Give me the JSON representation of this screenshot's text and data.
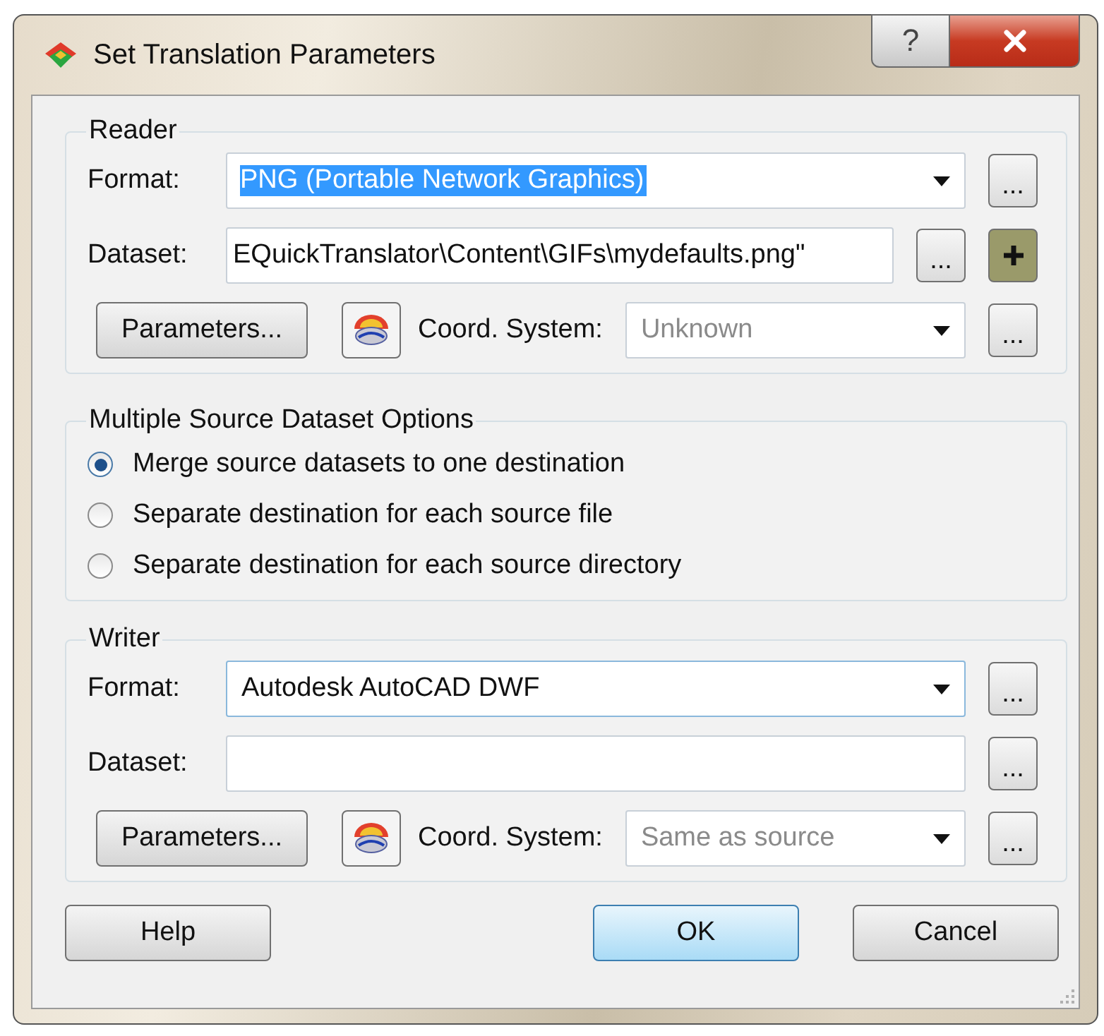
{
  "window": {
    "title": "Set Translation Parameters",
    "help_button": "?"
  },
  "reader": {
    "title": "Reader",
    "format": {
      "label": "Format:",
      "value": "PNG (Portable Network Graphics)",
      "selected": true,
      "browse": "..."
    },
    "dataset": {
      "label": "Dataset:",
      "value": "EQuickTranslator\\Content\\GIFs\\mydefaults.png\"",
      "browse": "..."
    },
    "parameters_button": "Parameters...",
    "coord_system": {
      "label": "Coord. System:",
      "value": "Unknown",
      "browse": "..."
    }
  },
  "source_options": {
    "title": "Multiple Source Dataset Options",
    "options": [
      {
        "label": "Merge source datasets to one destination",
        "selected": true
      },
      {
        "label": "Separate destination for each source file",
        "selected": false
      },
      {
        "label": "Separate destination for each source directory",
        "selected": false
      }
    ]
  },
  "writer": {
    "title": "Writer",
    "format": {
      "label": "Format:",
      "value": "Autodesk AutoCAD DWF",
      "selected": false,
      "browse": "..."
    },
    "dataset": {
      "label": "Dataset:",
      "browse": "..."
    },
    "parameters_button": "Parameters...",
    "coord_system": {
      "label": "Coord. System:",
      "value": "Same as source",
      "browse": "..."
    }
  },
  "buttons": [
    {
      "label": "Help",
      "focused": false
    },
    {
      "label": "OK",
      "focused": true
    },
    {
      "label": "Cancel",
      "focused": false
    }
  ]
}
